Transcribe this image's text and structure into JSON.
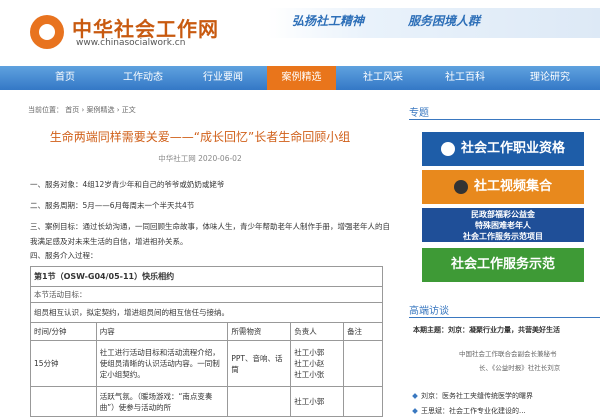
{
  "header": {
    "site_name": "中华社会工作网",
    "site_url": "www.chinasocialwork.cn",
    "slogan_left": "弘扬社工精神",
    "slogan_right": "服务困境人群"
  },
  "nav": [
    "首页",
    "工作动态",
    "行业要闻",
    "案例精选",
    "社工风采",
    "社工百科",
    "理论研究"
  ],
  "breadcrumb": "当前位置： 首页 › 案例精选 › 正文",
  "article": {
    "title": "生命两端同样需要关爱——“成长回忆”长者生命回顾小组",
    "meta": "中华社工网    2020-06-02",
    "paragraphs": [
      "一、服务对象：4组12岁青少年和自己的爷爷或奶奶或姥爷",
      "二、服务周期：5月——6月每周末一个半天共4节",
      "三、案例目标：通过长幼沟通，一同回顾生命故事，体味人生，青少年帮助老年人制作手册，增强老年人的自我满足感及对未来生活的自信，增进祖孙关系。",
      "四、服务介入过程："
    ],
    "section_header": "第1节（OSW-G04/05-11）快乐相约",
    "goal_label": "本节活动目标：",
    "goal_text": "组员相互认识，拟定契约，增进组员间的相互信任与接纳。",
    "table_headers": [
      "时间/分钟",
      "内容",
      "所需物资",
      "负责人",
      "备注"
    ],
    "rows": [
      {
        "time": "15分钟",
        "content": "社工进行活动目标和活动流程介绍，使组员清晰的认识活动内容。一同制定小组契约。",
        "materials": "PPT、音响、话筒",
        "persons": [
          "社工小郭",
          "社工小赵",
          "社工小张"
        ],
        "note": ""
      },
      {
        "time": "",
        "content": "活跃气氛。（暖场游戏：“南点变奏曲”）使参与活动的所",
        "materials": "",
        "persons": [
          "社工小郭"
        ],
        "note": ""
      }
    ]
  },
  "sidebar": {
    "title": "专题",
    "banners": [
      "社会工作职业资格",
      "社工视频集合",
      "民政部福彩公益金",
      "特殊困难老年人",
      "社会工作服务示范项目",
      "社会工作服务示范"
    ],
    "interview_title": "高端访谈",
    "interview_items": [
      "本期主题：刘京：凝聚行业力量，共营美好生活",
      "中国社会工作联合会副会长兼秘书",
      "长、《公益时报》社社长刘京",
      "刘京：医务社工夹缝传统医学的曙界",
      "王思斌：社会工作专业化建设的..."
    ]
  },
  "colors": {
    "brand_orange": "#e9751b",
    "nav_blue": "#3478c6",
    "title_orange": "#d0601a"
  }
}
